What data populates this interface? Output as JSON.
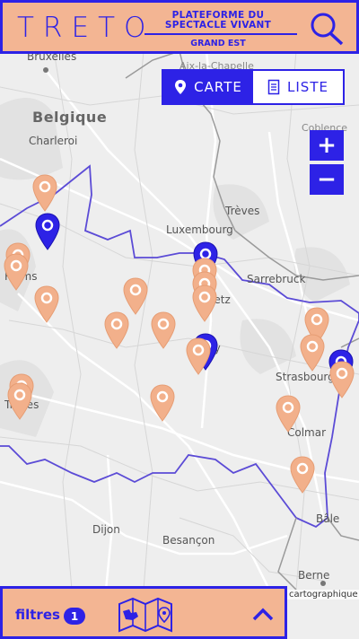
{
  "header": {
    "logo_text": "TRETO",
    "tagline_line1": "PLATEFORME DU",
    "tagline_line2": "SPECTACLE VIVANT",
    "region": "GRAND EST",
    "search_icon": "search-icon"
  },
  "view_toggle": {
    "map_label": "CARTE",
    "list_label": "LISTE",
    "active": "map",
    "map_icon": "location-pin-icon",
    "list_icon": "list-document-icon"
  },
  "zoom": {
    "in_label": "+",
    "out_label": "−"
  },
  "map_labels": {
    "bruxelles": "Bruxelles",
    "aix": "Aix-la-Chapelle",
    "belgique": "Belgique",
    "charleroi": "Charleroi",
    "coblence": "Coblence",
    "treves": "Trèves",
    "luxembourg": "Luxembourg",
    "sarrebruck": "Sarrebruck",
    "reims": "Reims",
    "metz": "Metz",
    "nancy": "cy",
    "strasbourg": "Strasbourg",
    "troyes": "Troyes",
    "colmar": "Colmar",
    "dijon": "Dijon",
    "besancon": "Besançon",
    "bale": "Bâle",
    "berne": "Berne"
  },
  "attribution": "cartographique",
  "bottom_bar": {
    "filters_label": "filtres",
    "filters_count": "1",
    "map_mode_icon": "folded-map-icon",
    "expand_icon": "chevron-up-icon"
  },
  "colors": {
    "accent": "#2d22e6",
    "brand_peach": "#f3b593",
    "pin_peach": "#f2b08b",
    "map_bg": "#eeeeee",
    "border_line": "#5b4bd6"
  }
}
